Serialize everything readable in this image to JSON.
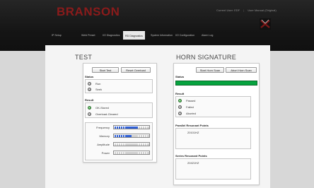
{
  "header": {
    "logo": "BRANSON",
    "links": [
      "Current User: EDF",
      "User Manual (Original)"
    ],
    "separator": "|",
    "colors": {
      "logo": "#8a1b1b",
      "bar": "#151515"
    }
  },
  "nav": {
    "tabs": [
      {
        "label": "IP Setup",
        "active": false
      },
      {
        "label": "Weld Preset",
        "active": false
      },
      {
        "label": "I/O Diagnostics",
        "active": false
      },
      {
        "label": "RD Diagnostics",
        "active": true
      },
      {
        "label": "System Information",
        "active": false
      },
      {
        "label": "I/O Configuration",
        "active": false
      },
      {
        "label": "Alarm Log",
        "active": false
      }
    ]
  },
  "test": {
    "title": "TEST",
    "start_label": "Start Test",
    "reset_label": "Reset Overload",
    "status_label": "Status",
    "status_items": [
      "Run",
      "Seek"
    ],
    "result_label": "Result",
    "result_items": [
      {
        "label": "OK-Stored",
        "state": "green"
      },
      {
        "label": "Overload-Cleared",
        "state": "grey"
      }
    ],
    "meters": [
      {
        "label": "Frequency",
        "level": 0.68
      },
      {
        "label": "Memory",
        "level": 0.52
      },
      {
        "label": "Amplitude",
        "level": 0.0
      },
      {
        "label": "Power",
        "level": 0.0
      }
    ]
  },
  "horn": {
    "title": "HORN SIGNATURE",
    "start_label": "Start Horn Scan",
    "abort_label": "Abort Horn Scan",
    "status_label": "Status",
    "status_progress": 1.0,
    "result_label": "Result",
    "result_items": [
      {
        "label": "Passed",
        "state": "green"
      },
      {
        "label": "Failed",
        "state": "grey"
      },
      {
        "label": "Aborted",
        "state": "grey"
      }
    ],
    "parallel_label": "Parallel Resonant Points",
    "parallel_value": "20101HZ",
    "series_label": "Series Resonant Points",
    "series_value": "20421HZ"
  }
}
